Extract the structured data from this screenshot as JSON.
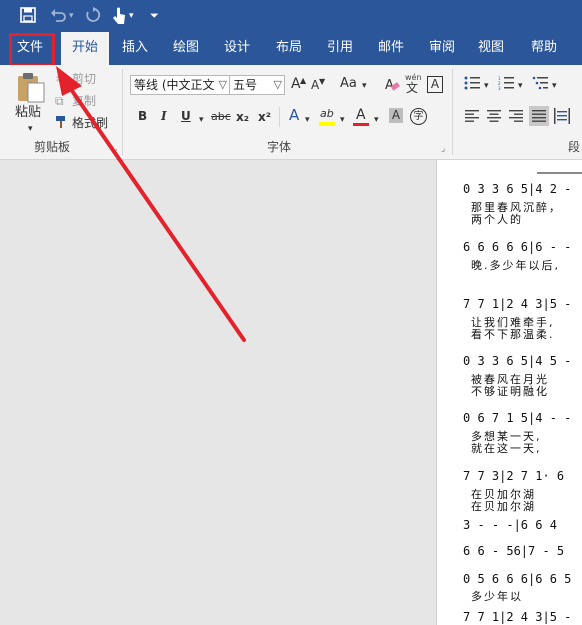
{
  "qat": {
    "icons": [
      "save-icon",
      "undo-icon",
      "redo-icon",
      "touch-mode-icon",
      "customize-qat-icon"
    ]
  },
  "tabs": [
    "文件",
    "开始",
    "插入",
    "绘图",
    "设计",
    "布局",
    "引用",
    "邮件",
    "审阅",
    "视图",
    "帮助"
  ],
  "clipboard": {
    "paste": "粘贴",
    "cut": "剪切",
    "copy": "复制",
    "format_painter": "格式刷",
    "group": "剪贴板"
  },
  "font": {
    "name": "等线 (中文正文",
    "size": "五号",
    "group": "字体",
    "grow": "A",
    "shrink": "A",
    "case": "Aa",
    "clear": "A",
    "phonetic_top": "wén",
    "phonetic_bottom": "文",
    "border": "A",
    "bold": "B",
    "italic": "I",
    "underline": "U",
    "strike": "abc",
    "sub": "x₂",
    "sup": "x²",
    "effects": "A",
    "highlight": "ab",
    "color": "A",
    "shade": "A",
    "enclose": "字"
  },
  "paragraph": {
    "group": "段"
  },
  "score": {
    "lines": [
      {
        "notes": "0 3 3 6 5|4 2 -",
        "lyric1": "那里春风沉醉，",
        "lyric2": "两个人的"
      },
      {
        "notes": "6 6 6 6 6|6 - -",
        "lyric1": "晚.多少年以后,",
        "lyric2": ""
      },
      {
        "notes": "7 7 1|2 4 3|5 -",
        "lyric1": "让我们难牵手,",
        "lyric2": "看不下那温柔."
      },
      {
        "notes": "0 3 3 6 5|4 5 -",
        "lyric1": "被春风在月光",
        "lyric2": "不够证明融化"
      },
      {
        "notes": "0 6 7 1 5|4 - -",
        "lyric1": "多想某一天,",
        "lyric2": "就在这一天,"
      },
      {
        "notes": "7 7 3|2 7 1· 6",
        "lyric1": "在贝加尔湖",
        "lyric2": "在贝加尔湖"
      },
      {
        "notes": "3 - - -|6 6 4",
        "lyric1": "",
        "lyric2": ""
      },
      {
        "notes": "6 6 - 56|7 - 5",
        "lyric1": "",
        "lyric2": ""
      },
      {
        "notes": "0 5 6 6 6|6 6 5",
        "lyric1": "多少年以",
        "lyric2": ""
      },
      {
        "notes": "7 7 1|2 4 3|5 -",
        "lyric1": "",
        "lyric2": ""
      }
    ]
  }
}
